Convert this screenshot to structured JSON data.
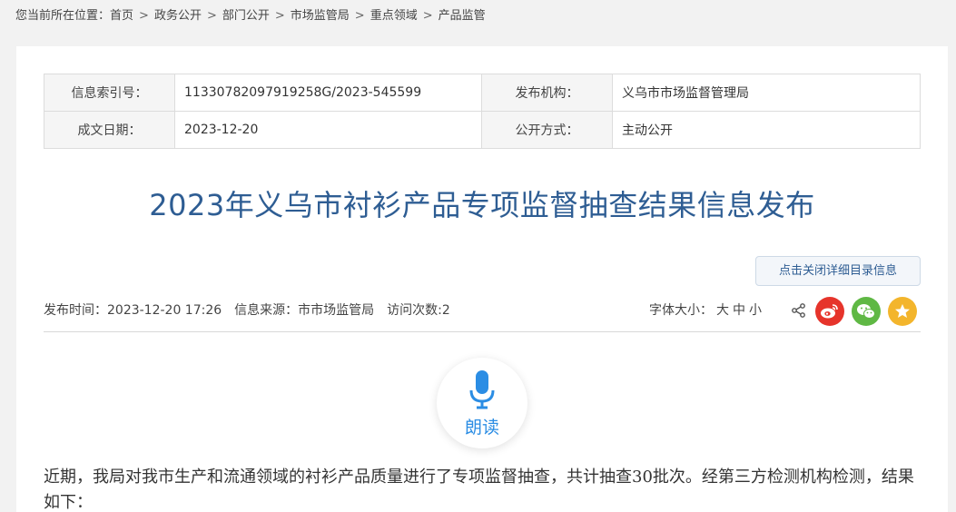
{
  "breadcrumb": {
    "label": "您当前所在位置：",
    "items": [
      "首页",
      "政务公开",
      "部门公开",
      "市场监管局",
      "重点领域",
      "产品监管"
    ]
  },
  "meta": {
    "index_label": "信息索引号：",
    "index_value": "11330782097919258G/2023-545599",
    "org_label": "发布机构：",
    "org_value": "义乌市市场监督管理局",
    "date_label": "成文日期：",
    "date_value": "2023-12-20",
    "mode_label": "公开方式：",
    "mode_value": "主动公开"
  },
  "article": {
    "title": "2023年义乌市衬衫产品专项监督抽查结果信息发布",
    "detail_toggle": "点击关闭详细目录信息",
    "publish_time": "发布时间：2023-12-20 17:26",
    "source": "信息来源：市市场监管局",
    "visits": "访问次数:2",
    "font_size_label": "字体大小：",
    "font_large": "大",
    "font_medium": "中",
    "font_small": "小",
    "read_label": "朗读",
    "body": "近期，我局对我市生产和流通领域的衬衫产品质量进行了专项监督抽查，共计抽查30批次。经第三方检测机构检测，结果如下："
  },
  "icons": {
    "share": "share-icon",
    "weibo": "weibo-icon",
    "wechat": "wechat-icon",
    "favorite": "star-icon",
    "microphone": "microphone-icon"
  },
  "colors": {
    "title": "#2e5d93",
    "weibo": "#e6342b",
    "wechat": "#5fb844",
    "favorite": "#f3b52c",
    "read": "#2b8de4"
  }
}
